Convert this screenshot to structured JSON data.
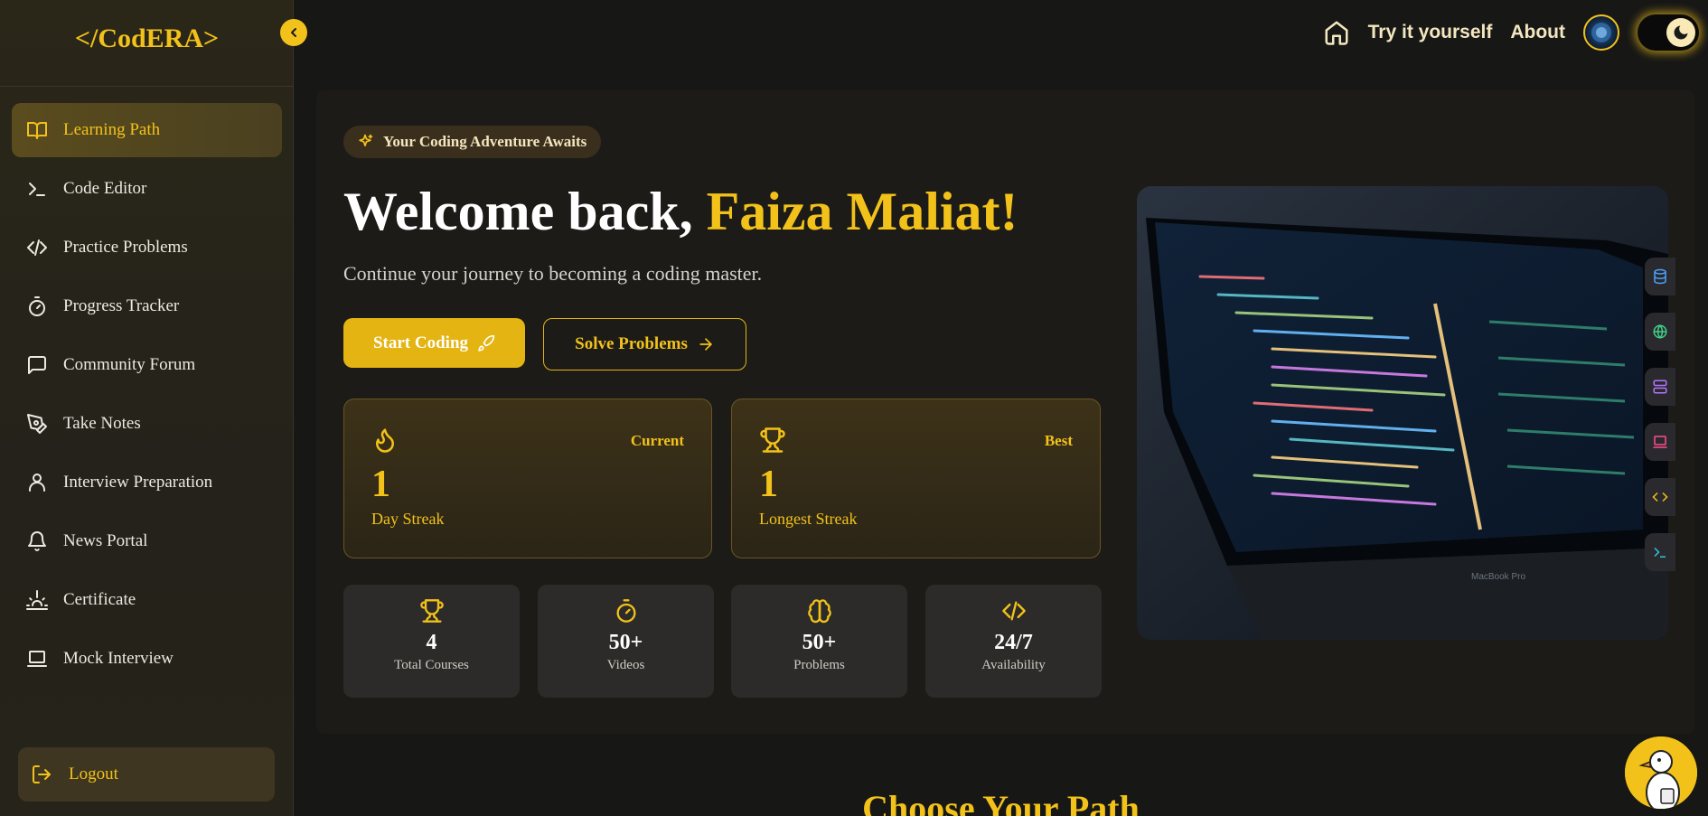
{
  "brand": {
    "logo": "</CodERA>"
  },
  "sidebar": {
    "items": [
      {
        "label": "Learning Path",
        "icon": "book-open-icon",
        "active": true
      },
      {
        "label": "Code Editor",
        "icon": "terminal-icon"
      },
      {
        "label": "Practice Problems",
        "icon": "code-icon"
      },
      {
        "label": "Progress Tracker",
        "icon": "timer-icon"
      },
      {
        "label": "Community Forum",
        "icon": "message-square-icon"
      },
      {
        "label": "Take Notes",
        "icon": "pen-tool-icon"
      },
      {
        "label": "Interview Preparation",
        "icon": "user-icon"
      },
      {
        "label": "News Portal",
        "icon": "bell-icon"
      },
      {
        "label": "Certificate",
        "icon": "sunrise-icon"
      },
      {
        "label": "Mock Interview",
        "icon": "laptop-icon"
      }
    ],
    "logout_label": "Logout"
  },
  "topnav": {
    "try_label": "Try it yourself",
    "about_label": "About"
  },
  "hero": {
    "badge": "Your Coding Adventure Awaits",
    "welcome_prefix": "Welcome back, ",
    "user_name": "Faiza Maliat!",
    "subtitle": "Continue your journey to becoming a coding master.",
    "start_label": "Start Coding",
    "solve_label": "Solve Problems"
  },
  "streaks": {
    "current": {
      "tag": "Current",
      "value": "1",
      "label": "Day Streak"
    },
    "best": {
      "tag": "Best",
      "value": "1",
      "label": "Longest Streak"
    }
  },
  "stats": [
    {
      "value": "4",
      "label": "Total Courses",
      "icon": "trophy-icon"
    },
    {
      "value": "50+",
      "label": "Videos",
      "icon": "timer-icon"
    },
    {
      "value": "50+",
      "label": "Problems",
      "icon": "brain-icon"
    },
    {
      "value": "24/7",
      "label": "Availability",
      "icon": "code-icon"
    }
  ],
  "section": {
    "title": "Choose Your Path"
  },
  "colors": {
    "accent": "#f2c21a",
    "background": "#171716",
    "sidebar": "#26231a"
  }
}
